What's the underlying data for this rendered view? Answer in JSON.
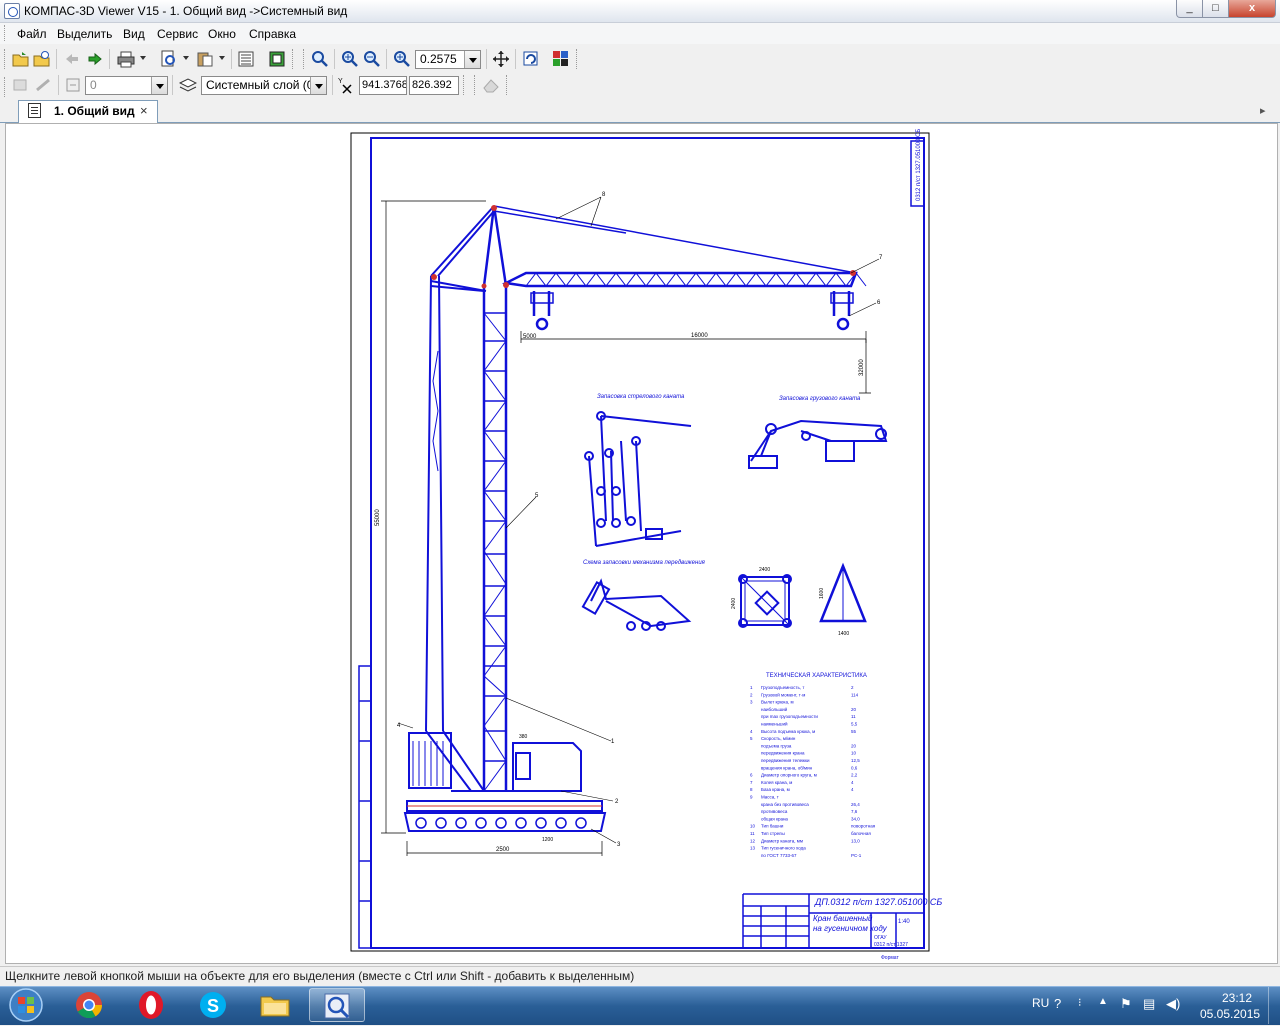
{
  "window": {
    "title": "КОМПАС-3D Viewer V15 - 1. Общий вид ->Системный вид",
    "minimize_glyph": "_",
    "maximize_glyph": "□",
    "close_glyph": "x"
  },
  "menu": {
    "items": [
      {
        "label": "Файл"
      },
      {
        "label": "Выделить"
      },
      {
        "label": "Вид"
      },
      {
        "label": "Сервис"
      },
      {
        "label": "Окно"
      },
      {
        "label": "Справка"
      }
    ]
  },
  "toolbar": {
    "zoom_value": "0.2575",
    "style_value": "0",
    "layer_value": "Системный слой (0)",
    "coord_x": "941.3768",
    "coord_y": "826.392",
    "coord_axis_label": "Y X"
  },
  "tabs": [
    {
      "label": "1. Общий вид",
      "close": "×"
    }
  ],
  "drawing": {
    "stamp_top": "ДП.0312 п/ст 1327.051000 СБ",
    "stamp_name_1": "Кран башенный",
    "stamp_name_2": "на гусеничном ходу",
    "stamp_group_1": "ОГАУ",
    "stamp_group_2": "0312 п/ст 1327",
    "stamp_sheet": "1:40",
    "stamp_format": "Формат",
    "frame_code": "0312 п/ст 1327.051000 СБ",
    "section_1": "Запасовка стрелового каната",
    "section_2": "Запасовка грузового каната",
    "section_3": "Схема запасовки механизма передвижения",
    "tech_title": "ТЕХНИЧЕСКАЯ ХАРАКТЕРИСТИКА",
    "dim_span": "16000",
    "dim_left": "5000",
    "dim_height": "55000",
    "dim_base": "2500",
    "dim_drop": "32000",
    "dim_box_w": "2400",
    "dim_box_h": "2400",
    "dim_tri_w": "1400",
    "dim_tri_h": "1600",
    "dim_small": "1200",
    "dim_small2": "380",
    "leaders": [
      "1",
      "2",
      "3",
      "4",
      "5",
      "6",
      "7",
      "8"
    ],
    "tech_rows": [
      [
        "1",
        "Грузоподъемность, т",
        "2"
      ],
      [
        "2",
        "Грузовой момент, т·м",
        "114"
      ],
      [
        "3",
        "Вылет крюка, м",
        ""
      ],
      [
        "",
        "наибольший",
        "20"
      ],
      [
        "",
        "при max грузоподъемности",
        "11"
      ],
      [
        "",
        "наименьший",
        "5,5"
      ],
      [
        "4",
        "Высота подъема крюка, м",
        "55"
      ],
      [
        "5",
        "Скорость, м/мин",
        ""
      ],
      [
        "",
        "подъема груза",
        "20"
      ],
      [
        "",
        "передвижения крана",
        "10"
      ],
      [
        "",
        "передвижения тележки",
        "12,5"
      ],
      [
        "",
        "вращения крана, об/мин",
        "0,6"
      ],
      [
        "6",
        "Диаметр опорного круга, м",
        "2,2"
      ],
      [
        "7",
        "Колея крана, м",
        "4"
      ],
      [
        "8",
        "База крана, м",
        "4"
      ],
      [
        "9",
        "Масса, т",
        ""
      ],
      [
        "",
        "крана без противовеса",
        "26,4"
      ],
      [
        "",
        "противовеса",
        "7,6"
      ],
      [
        "",
        "общая крана",
        "34,0"
      ],
      [
        "10",
        "Тип башни",
        "поворотная"
      ],
      [
        "11",
        "Тип стрелы",
        "балочная"
      ],
      [
        "12",
        "Диаметр каната, мм",
        "13,0"
      ],
      [
        "13",
        "Тип гусеничного хода",
        ""
      ],
      [
        "",
        "по ГОСТ 7733-67",
        "РС-1"
      ]
    ]
  },
  "status": {
    "text": "Щелкните левой кнопкой мыши на объекте для его выделения (вместе с Ctrl или Shift - добавить к выделенным)"
  },
  "taskbar": {
    "language": "RU",
    "time": "23:12",
    "date": "05.05.2015"
  },
  "colors": {
    "drawing_line": "#1010d8",
    "accent_red": "#d03030",
    "taskbar": "#2a5f97"
  }
}
